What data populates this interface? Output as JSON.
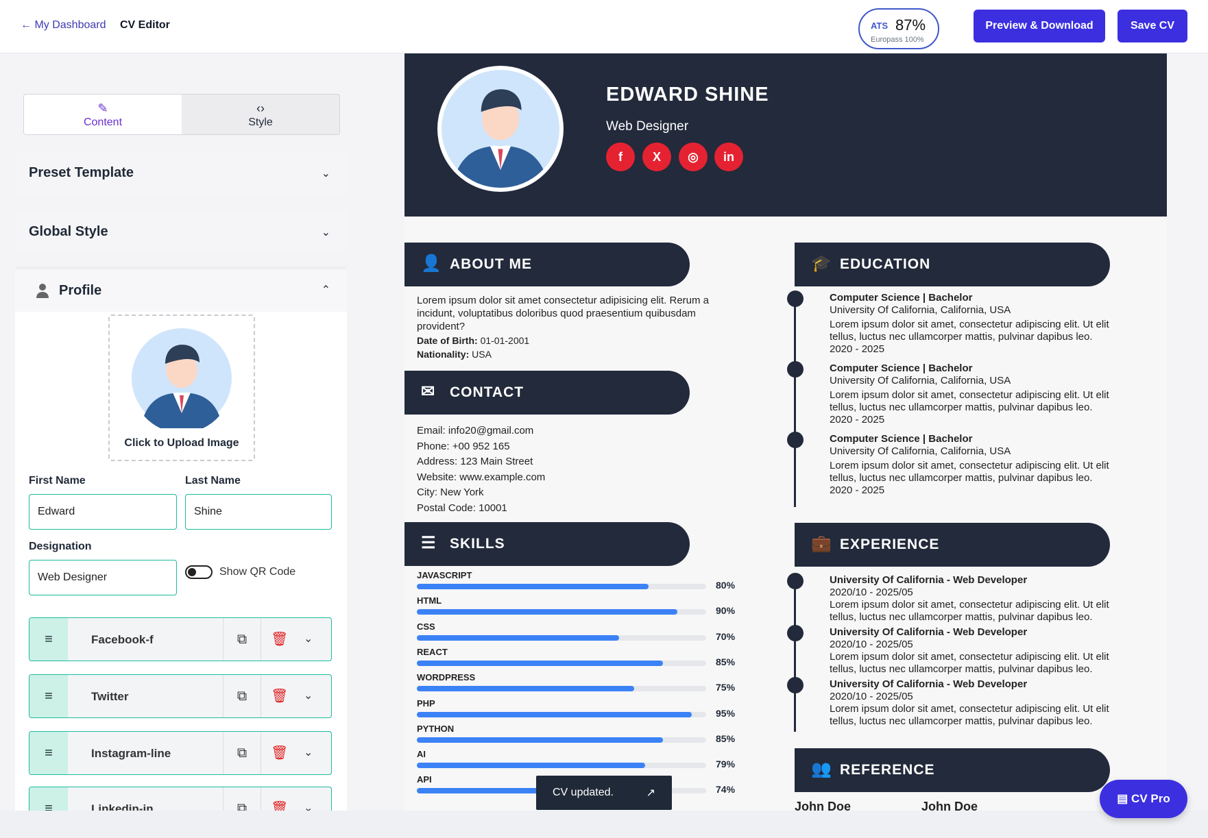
{
  "topbar": {
    "back": "← My Dashboard",
    "crumb": "CV Editor",
    "ats_label": "ATS",
    "ats_value": "87%",
    "ats_sub": "Europass 100%",
    "preview": "Preview & Download",
    "save": "Save CV"
  },
  "editor": {
    "tab_content": "Content",
    "tab_style": "Style",
    "preset": "Preset Template",
    "global": "Global Style",
    "profile": "Profile",
    "upload": "Click to Upload Image",
    "first_label": "First Name",
    "first_value": "Edward",
    "last_label": "Last Name",
    "last_value": "Shine",
    "desig_label": "Designation",
    "desig_value": "Web Designer",
    "qr": "Show QR Code",
    "socials": [
      "Facebook-f",
      "Twitter",
      "Instagram-line",
      "Linkedin-in"
    ]
  },
  "cv": {
    "first": "EDWARD",
    "last": "SHINE",
    "designation": "Web Designer",
    "social_icons": [
      "f",
      "X",
      "◎",
      "in"
    ],
    "about": {
      "title": "ABOUT ME",
      "text": "Lorem ipsum dolor sit amet consectetur adipisicing elit. Rerum a incidunt, voluptatibus doloribus quod praesentium quibusdam provident?",
      "dob_label": "Date of Birth:",
      "dob": "01-01-2001",
      "nat_label": "Nationality:",
      "nat": "USA"
    },
    "contact": {
      "title": "CONTACT",
      "items": [
        {
          "k": "Email:",
          "v": "info20@gmail.com"
        },
        {
          "k": "Phone:",
          "v": "+00 952 165"
        },
        {
          "k": "Address:",
          "v": "123 Main Street"
        },
        {
          "k": "Website:",
          "v": "www.example.com"
        },
        {
          "k": "City:",
          "v": "New York"
        },
        {
          "k": "Postal Code:",
          "v": "10001"
        }
      ]
    },
    "skills": {
      "title": "SKILLS",
      "items": [
        {
          "name": "JAVASCRIPT",
          "pct": "80%",
          "level": 0.8
        },
        {
          "name": "HTML",
          "pct": "90%",
          "level": 0.9
        },
        {
          "name": "CSS",
          "pct": "70%",
          "level": 0.7
        },
        {
          "name": "REACT",
          "pct": "85%",
          "level": 0.85
        },
        {
          "name": "WORDPRESS",
          "pct": "75%",
          "level": 0.75
        },
        {
          "name": "PHP",
          "pct": "95%",
          "level": 0.95
        },
        {
          "name": "PYTHON",
          "pct": "85%",
          "level": 0.85
        },
        {
          "name": "AI",
          "pct": "79%",
          "level": 0.79
        },
        {
          "name": "API",
          "pct": "74%",
          "level": 0.74
        }
      ]
    },
    "education": {
      "title": "EDUCATION",
      "items": [
        {
          "t": "Computer Science",
          "deg": "Bachelor",
          "school": "University Of California, California, USA",
          "desc": "Lorem ipsum dolor sit amet, consectetur adipiscing elit. Ut elit tellus, luctus nec ullamcorper mattis, pulvinar dapibus leo.",
          "years": "2020 - 2025"
        },
        {
          "t": "Computer Science",
          "deg": "Bachelor",
          "school": "University Of California, California, USA",
          "desc": "Lorem ipsum dolor sit amet, consectetur adipiscing elit. Ut elit tellus, luctus nec ullamcorper mattis, pulvinar dapibus leo.",
          "years": "2020 - 2025"
        },
        {
          "t": "Computer Science",
          "deg": "Bachelor",
          "school": "University Of California, California, USA",
          "desc": "Lorem ipsum dolor sit amet, consectetur adipiscing elit. Ut elit tellus, luctus nec ullamcorper mattis, pulvinar dapibus leo.",
          "years": "2020 - 2025"
        }
      ]
    },
    "experience": {
      "title": "EXPERIENCE",
      "items": [
        {
          "t": "University Of California",
          "role": "Web Developer",
          "dates": "2020/10 - 2025/05",
          "desc": "Lorem ipsum dolor sit amet, consectetur adipiscing elit. Ut elit tellus, luctus nec ullamcorper mattis, pulvinar dapibus leo."
        },
        {
          "t": "University Of California",
          "role": "Web Developer",
          "dates": "2020/10 - 2025/05",
          "desc": "Lorem ipsum dolor sit amet, consectetur adipiscing elit. Ut elit tellus, luctus nec ullamcorper mattis, pulvinar dapibus leo."
        },
        {
          "t": "University Of California",
          "role": "Web Developer",
          "dates": "2020/10 - 2025/05",
          "desc": "Lorem ipsum dolor sit amet, consectetur adipiscing elit. Ut elit tellus, luctus nec ullamcorper mattis, pulvinar dapibus leo."
        }
      ]
    },
    "reference": {
      "title": "REFERENCE",
      "names": [
        "John Doe",
        "John Doe"
      ]
    }
  },
  "toast": "CV updated.",
  "fab": "CV Pro",
  "colors": {
    "accent": "#3b2fe0",
    "dark": "#222a3b",
    "teal": "#1abc9c",
    "red": "#e52231",
    "bar": "#3b82f6"
  }
}
